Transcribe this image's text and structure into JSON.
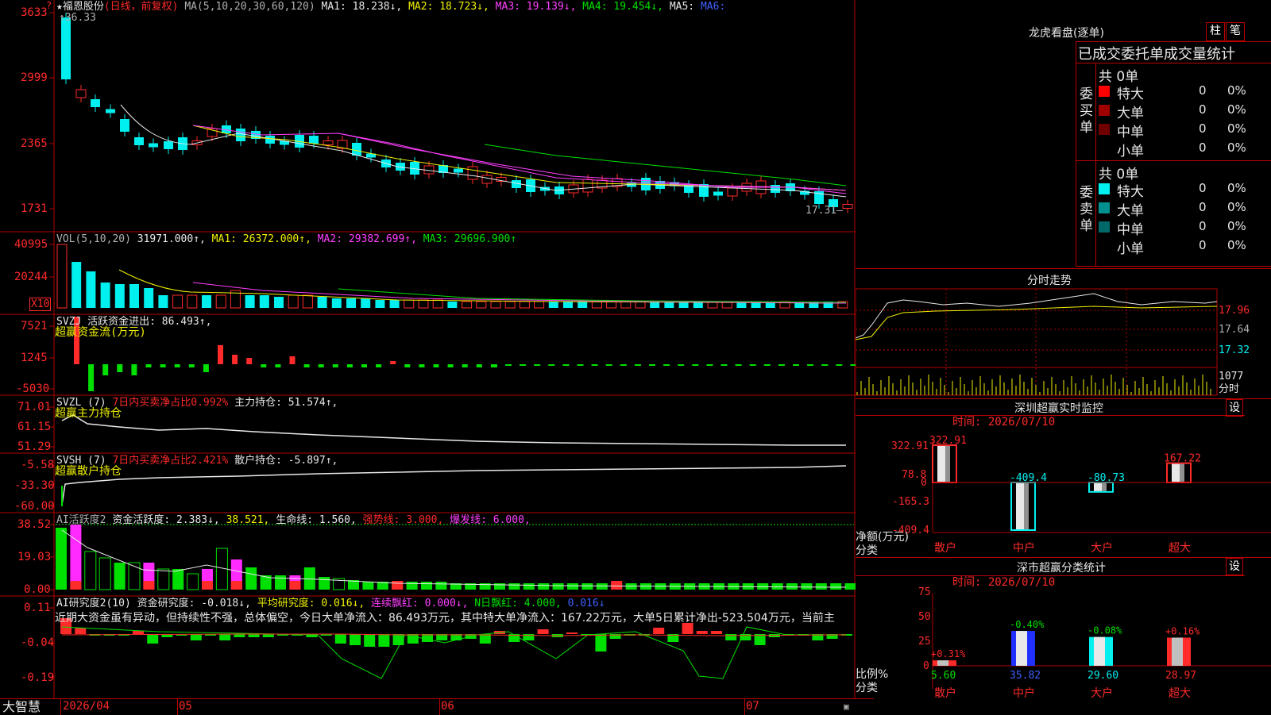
{
  "header": {
    "stock_label": "★福恩股份",
    "mode": "(日线，前复权)",
    "ma_prefix": "MA(5,10,20,30,60,120)",
    "ma1": "MA1: 18.238↓,",
    "ma2": "MA2: 18.723↓,",
    "ma3": "MA3: 19.139↓,",
    "ma4": "MA4: 19.454↓,",
    "ma5": "MA5:",
    "ma6": "MA6:",
    "high_marker": "↑36.33",
    "low_marker": "17.31—"
  },
  "price_axis": [
    "3633",
    "2999",
    "2365",
    "1731"
  ],
  "vol_panel": {
    "title": "VOL(5,10,20)",
    "value": "31971.000↑,",
    "ma1": "MA1: 26372.000↑,",
    "ma2": "MA2: 29382.699↑,",
    "ma3": "MA3: 29696.900↑",
    "axis": [
      "40995",
      "20244"
    ],
    "unit": "X10"
  },
  "svzj_panel": {
    "title": "SVZJ  活跃资金进出: 86.493↑,",
    "subtitle": "超赢资金流(万元)",
    "axis": [
      "7521",
      "1245",
      "-5030"
    ]
  },
  "svzl_panel": {
    "title_a": "SVZL (7)",
    "title_b": "7日内买卖净占比0.992%",
    "title_c": "主力持仓: 51.574↑,",
    "subtitle": "超赢主力持仓",
    "axis": [
      "71.01",
      "61.15",
      "51.29"
    ]
  },
  "svsh_panel": {
    "title_a": "SVSH (7)",
    "title_b": "7日内买卖净占比2.421%",
    "title_c": "散户持仓: -5.897↑,",
    "subtitle": "超赢散户持仓",
    "axis": [
      "-5.58",
      "-33.30",
      "-60.00"
    ]
  },
  "ai_active_panel": {
    "title_a": "AI活跃度2",
    "title_b": "资金活跃度: 2.383↓,",
    "title_c": "38.521,",
    "title_d": "生命线: 1.560,",
    "title_e": "强势线: 3.000,",
    "title_f": "爆发线: 6.000,",
    "axis": [
      "38.52",
      "19.03",
      "0.00"
    ]
  },
  "ai_research_panel": {
    "title_a": "AI研究度2(10)",
    "title_b": "资金研究度: -0.018↓,",
    "title_c": "平均研究度: 0.016↓,",
    "title_d": "连续飘红: 0.000↓,",
    "title_e": "N日飘红: 4.000,",
    "title_f": "0.016↓",
    "commentary": "近期大资金虽有异动，但持续性不强，总体偏空，今日大单净流入：86.493万元，其中特大单净流入：167.22万元，大单5日累计净出-523.504万元，当前主",
    "axis": [
      "0.11",
      "-0.04",
      "-0.19"
    ]
  },
  "bottom": {
    "logo": "大智慧",
    "dates": [
      "2026/04",
      "05",
      "06",
      "07"
    ]
  },
  "dragon_panel": {
    "title": "龙虎看盘(逐单)",
    "btn_bar": "柱",
    "btn_pen": "笔",
    "header": "已成交委托单成交量统计",
    "buy_label": "委买单",
    "buy_total": "共 0单",
    "sell_label": "委卖单",
    "sell_total": "共 0单",
    "buy_rows": [
      {
        "name": "特大",
        "count": "0",
        "pct": "0%",
        "color": "#ff0000"
      },
      {
        "name": "大单",
        "count": "0",
        "pct": "0%",
        "color": "#a00000"
      },
      {
        "name": "中单",
        "count": "0",
        "pct": "0%",
        "color": "#700000"
      },
      {
        "name": "小单",
        "count": "0",
        "pct": "0%",
        "color": "#000000"
      }
    ],
    "sell_rows": [
      {
        "name": "特大",
        "count": "0",
        "pct": "0%",
        "color": "#00f0f0"
      },
      {
        "name": "大单",
        "count": "0",
        "pct": "0%",
        "color": "#009090"
      },
      {
        "name": "中单",
        "count": "0",
        "pct": "0%",
        "color": "#006868"
      },
      {
        "name": "小单",
        "count": "0",
        "pct": "0%",
        "color": "#000000"
      }
    ]
  },
  "intraday_panel": {
    "title": "分时走势",
    "axis": [
      "17.96",
      "17.64",
      "17.32"
    ],
    "vol_axis": "1077",
    "vol_label": "分时"
  },
  "sz_monitor": {
    "title": "深圳超赢实时监控",
    "btn": "设",
    "time": "时间: 2026/07/10",
    "axis": [
      "322.91",
      "78.8",
      "0",
      "-165.3",
      "-409.4"
    ],
    "ylabel": "净额(万元)",
    "xlabel": "分类",
    "categories": [
      "散户",
      "中户",
      "大户",
      "超大"
    ],
    "values": [
      322.91,
      -409.4,
      -80.73,
      167.22
    ],
    "value_labels": [
      "322.91",
      "-409.4",
      "-80.73",
      "167.22"
    ]
  },
  "sz_class": {
    "title": "深市超赢分类统计",
    "btn": "设",
    "time": "时间: 2026/07/10",
    "axis": [
      "75",
      "50",
      "25",
      "0"
    ],
    "ylabel": "比例%",
    "xlabel": "分类",
    "categories": [
      "散户",
      "中户",
      "大户",
      "超大"
    ],
    "values": [
      5.6,
      35.82,
      29.6,
      28.97
    ],
    "value_labels": [
      "5.60",
      "35.82",
      "29.60",
      "28.97"
    ],
    "change_labels": [
      "+0.31%",
      "-0.40%",
      "-0.08%",
      "+0.16%"
    ]
  },
  "chart_data": [
    {
      "type": "bar",
      "title": "深圳超赢实时监控",
      "categories": [
        "散户",
        "中户",
        "大户",
        "超大"
      ],
      "values": [
        322.91,
        -409.4,
        -80.73,
        167.22
      ],
      "ylabel": "净额(万元)",
      "xlabel": "分类",
      "ylim": [
        -409.4,
        322.91
      ]
    },
    {
      "type": "bar",
      "title": "深市超赢分类统计",
      "categories": [
        "散户",
        "中户",
        "大户",
        "超大"
      ],
      "values": [
        5.6,
        35.82,
        29.6,
        28.97
      ],
      "ylabel": "比例%",
      "xlabel": "分类",
      "ylim": [
        0,
        75
      ]
    }
  ]
}
